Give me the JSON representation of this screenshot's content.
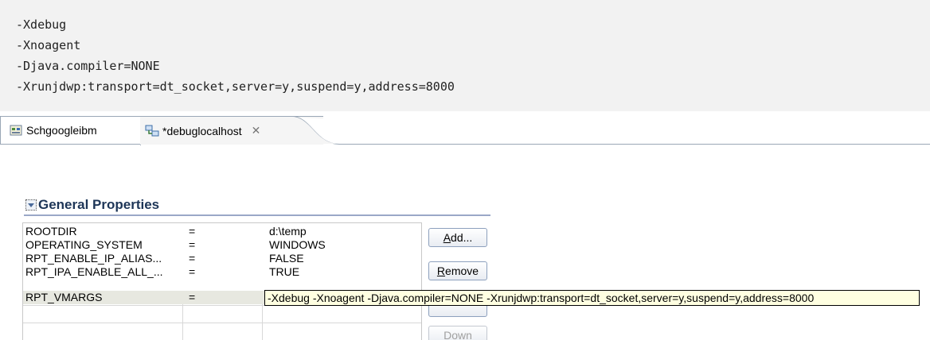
{
  "code_block": {
    "lines": [
      "-Xdebug",
      "-Xnoagent",
      "-Djava.compiler=NONE",
      "-Xrunjdwp:transport=dt_socket,server=y,suspend=y,address=8000"
    ]
  },
  "tabs": [
    {
      "label": "Schgoogleibm",
      "icon": "project-icon"
    },
    {
      "label": "*debuglocalhost",
      "icon": "launch-config-icon",
      "close": "✕"
    }
  ],
  "section": {
    "title": "General Properties"
  },
  "properties": {
    "rows": [
      {
        "key": "ROOTDIR",
        "op": "=",
        "value": "d:\\temp"
      },
      {
        "key": "OPERATING_SYSTEM",
        "op": "=",
        "value": "WINDOWS"
      },
      {
        "key": "RPT_ENABLE_IP_ALIAS...",
        "op": "=",
        "value": "FALSE"
      },
      {
        "key": "RPT_IPA_ENABLE_ALL_...",
        "op": "=",
        "value": "TRUE"
      },
      {
        "key": "RPT_VMARGS",
        "op": "=",
        "value": ""
      }
    ]
  },
  "buttons": {
    "add": {
      "mnemonic": "A",
      "rest": "dd..."
    },
    "remove": {
      "mnemonic": "R",
      "rest": "emove"
    },
    "down": {
      "label": "Down"
    }
  },
  "tooltip": "-Xdebug -Xnoagent -Djava.compiler=NONE -Xrunjdwp:transport=dt_socket,server=y,suspend=y,address=8000",
  "colors": {
    "selected_row": "#e7e8e0",
    "tooltip_bg": "#ffffe1",
    "section_title": "#1d3557"
  }
}
